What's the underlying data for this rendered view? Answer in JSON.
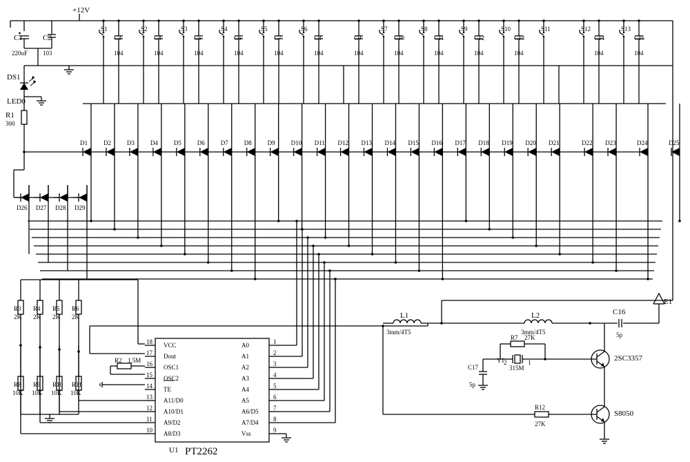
{
  "rails": {
    "vcc_label": "+12V"
  },
  "c_first": {
    "ref": "C1",
    "val": "220uF"
  },
  "c_decouple": {
    "ref": "C2",
    "val": "103"
  },
  "led": {
    "ref": "DS1",
    "label": "LED0"
  },
  "r_led": {
    "ref": "R1",
    "val": "300"
  },
  "switches": [
    {
      "s": "S1",
      "c": "C3",
      "cv": "104"
    },
    {
      "s": "S2",
      "c": "C4",
      "cv": "104"
    },
    {
      "s": "S3",
      "c": "C5",
      "cv": "104"
    },
    {
      "s": "S4",
      "c": "C6",
      "cv": "104"
    },
    {
      "s": "S5",
      "c": "C7",
      "cv": "104"
    },
    {
      "s": "S6",
      "c": "C8",
      "cv": "104"
    },
    {
      "s": "",
      "c": "C9",
      "cv": "104"
    },
    {
      "s": "S7",
      "c": "C10",
      "cv": "104"
    },
    {
      "s": "S8",
      "c": "C11",
      "cv": "104"
    },
    {
      "s": "S9",
      "c": "C12",
      "cv": "104"
    },
    {
      "s": "S10",
      "c": "C13",
      "cv": "104"
    },
    {
      "s": "S11",
      "c": "",
      "cv": ""
    },
    {
      "s": "S12",
      "c": "C14",
      "cv": "104"
    },
    {
      "s": "S13",
      "c": "C15",
      "cv": "104"
    }
  ],
  "diodes_top": [
    "D1",
    "D2",
    "D3",
    "D4",
    "D5",
    "D6",
    "D7",
    "D8",
    "D9",
    "D10",
    "D11",
    "D12",
    "D13",
    "D14",
    "D15",
    "D16",
    "D17",
    "D18",
    "D19",
    "D20",
    "D21",
    "D22",
    "D23",
    "D24",
    "D25"
  ],
  "diodes_low": [
    "D26",
    "D27",
    "D28",
    "D29"
  ],
  "r_up": [
    {
      "ref": "R3",
      "val": "2K"
    },
    {
      "ref": "R4",
      "val": "2K"
    },
    {
      "ref": "R5",
      "val": "2K"
    },
    {
      "ref": "R6",
      "val": "2K"
    }
  ],
  "r_dn": [
    {
      "ref": "R8",
      "val": "10K"
    },
    {
      "ref": "R9",
      "val": "10K"
    },
    {
      "ref": "R10",
      "val": "10K"
    },
    {
      "ref": "R11",
      "val": "10K"
    }
  ],
  "r_osc": {
    "ref": "R2",
    "val": "1.5M"
  },
  "ic": {
    "ref": "U1",
    "part": "PT2262",
    "left": [
      {
        "pin": "18",
        "name": "VCC"
      },
      {
        "pin": "17",
        "name": "Dout"
      },
      {
        "pin": "16",
        "name": "OSC1"
      },
      {
        "pin": "15",
        "name": "OSC2"
      },
      {
        "pin": "14",
        "name": "TE"
      },
      {
        "pin": "13",
        "name": "A11/D0"
      },
      {
        "pin": "12",
        "name": "A10/D1"
      },
      {
        "pin": "11",
        "name": "A9/D2"
      },
      {
        "pin": "10",
        "name": "A8/D3"
      }
    ],
    "right_names": [
      "A0",
      "A1",
      "A2",
      "A3",
      "A4",
      "A5",
      "A6/D5",
      "A7/D4",
      "Vss"
    ],
    "right_pins": [
      "1",
      "2",
      "3",
      "4",
      "5",
      "6",
      "7",
      "8",
      "9"
    ]
  },
  "rf": {
    "L1": {
      "ref": "L1",
      "val": "3mm/4T5"
    },
    "L2": {
      "ref": "L2",
      "val": "3mm/4T5"
    },
    "C16": {
      "ref": "C16",
      "val": "5p"
    },
    "C17": {
      "ref": "C17",
      "val": "5p"
    },
    "ant": "E1",
    "R7": {
      "ref": "R7",
      "val": "27K"
    },
    "Y1": {
      "ref": "Y1",
      "val": "315M"
    },
    "Q1": "2SC3357",
    "Q2": "S8050",
    "R12": {
      "ref": "R12",
      "val": "27K"
    }
  }
}
